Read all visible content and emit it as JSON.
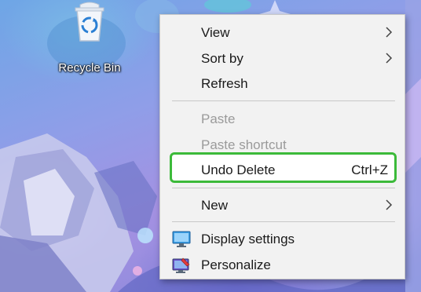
{
  "desktop": {
    "recycle_bin": {
      "label": "Recycle Bin",
      "icon": "recycle-bin-icon"
    }
  },
  "context_menu": {
    "items": [
      {
        "label": "View",
        "has_submenu": true,
        "enabled": true
      },
      {
        "label": "Sort by",
        "has_submenu": true,
        "enabled": true
      },
      {
        "label": "Refresh",
        "enabled": true
      },
      {
        "label": "Paste",
        "enabled": false
      },
      {
        "label": "Paste shortcut",
        "enabled": false
      },
      {
        "label": "Undo Delete",
        "shortcut": "Ctrl+Z",
        "enabled": true,
        "highlighted": true
      },
      {
        "label": "New",
        "has_submenu": true,
        "enabled": true
      },
      {
        "label": "Display settings",
        "icon": "display-settings-icon",
        "enabled": true
      },
      {
        "label": "Personalize",
        "icon": "personalize-icon",
        "enabled": true
      }
    ]
  },
  "colors": {
    "menu_background": "#f2f2f2",
    "highlight_border": "#3cba3a",
    "disabled_text": "#9a9a9a"
  }
}
